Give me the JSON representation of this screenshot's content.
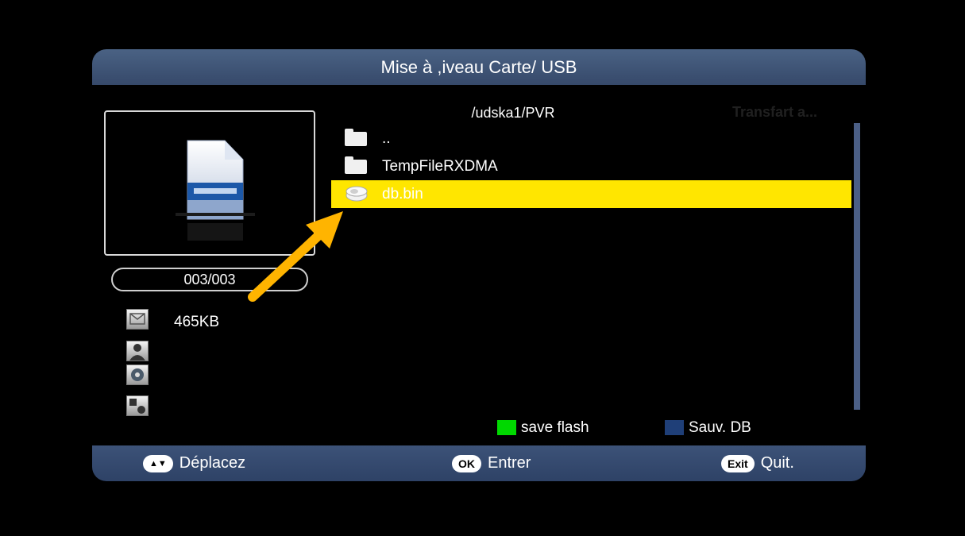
{
  "title": "Mise à ,iveau Carte/ USB",
  "path": "/udska1/PVR",
  "transfer_label": "Transfart a...",
  "preview": {
    "counter": "003/003",
    "file_size": "465KB",
    "side_icons": [
      "mail-icon",
      "user-icon",
      "disc-icon",
      "shapes-icon"
    ]
  },
  "files": [
    {
      "name": "..",
      "icon": "folder-icon"
    },
    {
      "name": "TempFileRXDMA",
      "icon": "folder-icon"
    },
    {
      "name": "db.bin",
      "icon": "database-icon",
      "selected": true
    }
  ],
  "legend": {
    "save_flash": "save flash",
    "save_flash_color": "#00d800",
    "sauv_db": "Sauv. DB",
    "sauv_db_color": "#1f3f78"
  },
  "footer": {
    "move_key": "▲▼",
    "move_label": "Déplacez",
    "ok_key": "OK",
    "ok_label": "Entrer",
    "exit_key": "Exit",
    "exit_label": "Quit."
  },
  "colors": {
    "title_bar": "#3f5578",
    "selection": "#ffe600",
    "annotation_arrow": "#ffb400"
  }
}
